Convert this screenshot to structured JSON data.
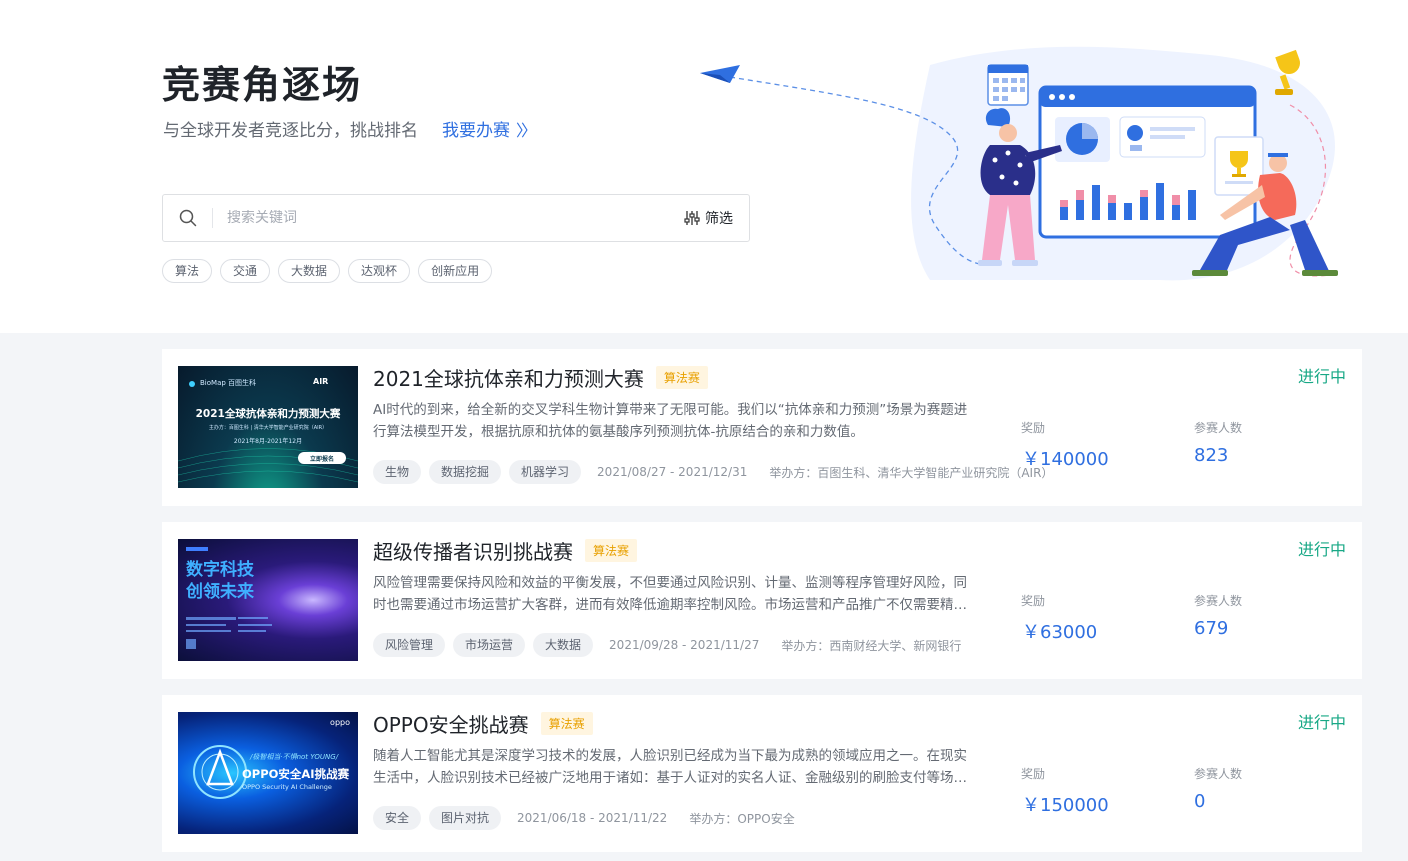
{
  "hero": {
    "title": "竞赛角逐场",
    "subtitle": "与全球开发者竞逐比分，挑战排名",
    "host_link": "我要办赛",
    "host_link_chevron": "〉〉",
    "search": {
      "placeholder": "搜索关键词",
      "filter_label": "筛选"
    },
    "tags": [
      "算法",
      "交通",
      "大数据",
      "达观杯",
      "创新应用"
    ]
  },
  "labels": {
    "prize": "奖励",
    "participants": "参赛人数"
  },
  "competitions": [
    {
      "title": "2021全球抗体亲和力预测大赛",
      "badge": "算法赛",
      "status": "进行中",
      "description": "AI时代的到来，给全新的交叉学科生物计算带来了无限可能。我们以“抗体亲和力预测”场景为赛题进行算法模型开发，根据抗原和抗体的氨基酸序列预测抗体-抗原结合的亲和力数值。",
      "tags": [
        "生物",
        "数据挖掘",
        "机器学习"
      ],
      "date": "2021/08/27 - 2021/12/31",
      "organizer": "举办方：百图生科、清华大学智能产业研究院（AIR）",
      "prize": "￥140000",
      "participants": "823",
      "thumb": {
        "logo_left": "BioMap 百图生科",
        "logo_right": "AIR",
        "headline": "2021全球抗体亲和力预测大赛",
        "host_line": "主办方：百图生科 | 清华大学智能产业研究院（AIR）",
        "date_line": "2021年8月-2021年12月",
        "button": "立即报名"
      }
    },
    {
      "title": "超级传播者识别挑战赛",
      "badge": "算法赛",
      "status": "进行中",
      "description": "风险管理需要保持风险和效益的平衡发展，不但要通过风险识别、计量、监测等程序管理好风险，同时也需要通过市场运营扩大客群，进而有效降低逾期率控制风险。市场运营和产品推广不仅需要精准的营销策略，更需要识别具有传播能力的超级传播者。",
      "tags": [
        "风险管理",
        "市场运营",
        "大数据"
      ],
      "date": "2021/09/28 - 2021/11/27",
      "organizer": "举办方：西南财经大学、新网银行",
      "prize": "￥63000",
      "participants": "679",
      "thumb": {
        "headline1": "数字科技",
        "headline2": "创领未来"
      }
    },
    {
      "title": "OPPO安全挑战赛",
      "badge": "算法赛",
      "status": "进行中",
      "description": "随着人工智能尤其是深度学习技术的发展，人脸识别已经成为当下最为成熟的领域应用之一。在现实生活中，人脸识别技术已经被广泛地用于诸如：基于人证对的实名人证、金融级别的刷脸支付等场景。",
      "tags": [
        "安全",
        "图片对抗"
      ],
      "date": "2021/06/18 - 2021/11/22",
      "organizer": "举办方：OPPO安全",
      "prize": "￥150000",
      "participants": "0",
      "thumb": {
        "brand": "oppo",
        "slogan": "/极智相当·不惧not YOUNG/",
        "headline": "OPPO安全AI挑战赛",
        "sub": "OPPO Security AI Challenge"
      }
    }
  ],
  "colors": {
    "accent": "#2f6fe0",
    "status": "#18a886",
    "badge": "#e8a000"
  }
}
